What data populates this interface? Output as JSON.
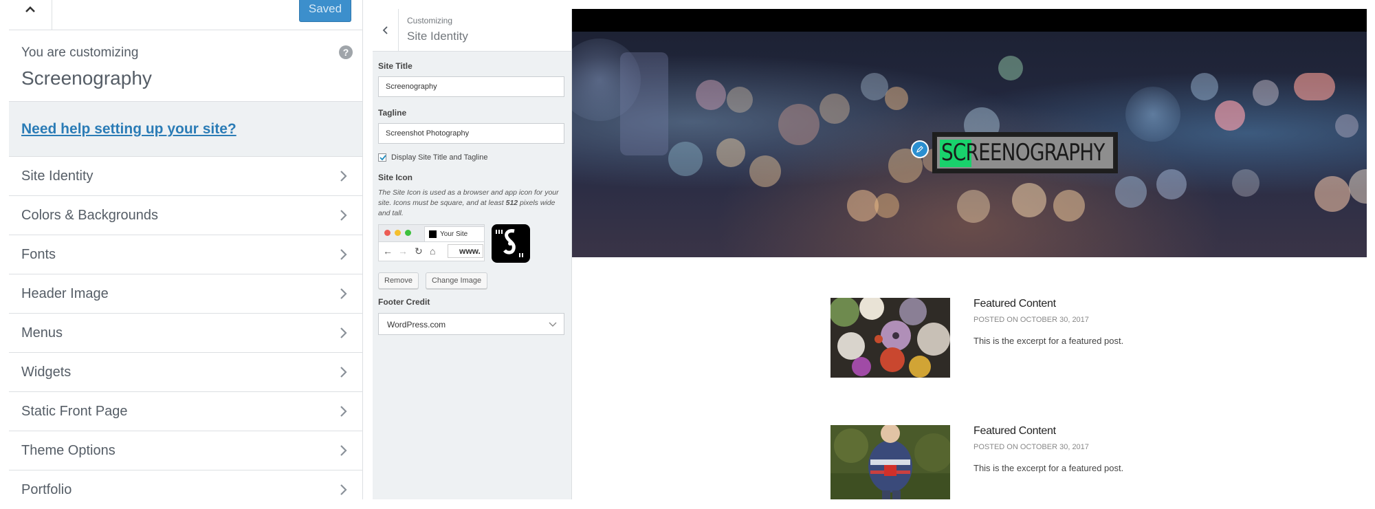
{
  "customizer": {
    "save_label": "Saved",
    "customizing_label": "You are customizing",
    "site_name": "Screenography",
    "help_link": "Need help setting up your site?",
    "menu": [
      {
        "label": "Site Identity"
      },
      {
        "label": "Colors & Backgrounds"
      },
      {
        "label": "Fonts"
      },
      {
        "label": "Header Image"
      },
      {
        "label": "Menus"
      },
      {
        "label": "Widgets"
      },
      {
        "label": "Static Front Page"
      },
      {
        "label": "Theme Options"
      },
      {
        "label": "Portfolio"
      }
    ]
  },
  "section": {
    "breadcrumb": "Customizing",
    "title": "Site Identity",
    "site_title_label": "Site Title",
    "site_title_value": "Screenography",
    "tagline_label": "Tagline",
    "tagline_value": "Screenshot Photography",
    "display_checkbox_label": "Display Site Title and Tagline",
    "display_checkbox_checked": true,
    "site_icon_label": "Site Icon",
    "site_icon_desc_1": "The Site Icon is used as a browser and app icon for your site. Icons must be square, and at least ",
    "site_icon_desc_bold": "512",
    "site_icon_desc_2": " pixels wide and tall.",
    "browser_tab_label": "Your Site",
    "browser_url": "www.",
    "remove_label": "Remove",
    "change_image_label": "Change Image",
    "footer_credit_label": "Footer Credit",
    "footer_credit_value": "WordPress.com"
  },
  "preview": {
    "logo_text": "SCREENOGRAPHY",
    "posts": [
      {
        "title": "Featured Content",
        "date": "POSTED ON OCTOBER 30, 2017",
        "excerpt": "This is the excerpt for a featured post."
      },
      {
        "title": "Featured Content",
        "date": "POSTED ON OCTOBER 30, 2017",
        "excerpt": "This is the excerpt for a featured post."
      }
    ]
  },
  "colors": {
    "accent_blue": "#3c8fcc",
    "link_blue": "#2b7cb6",
    "logo_green": "#19d26c",
    "panel_bg": "#eef1f3"
  }
}
